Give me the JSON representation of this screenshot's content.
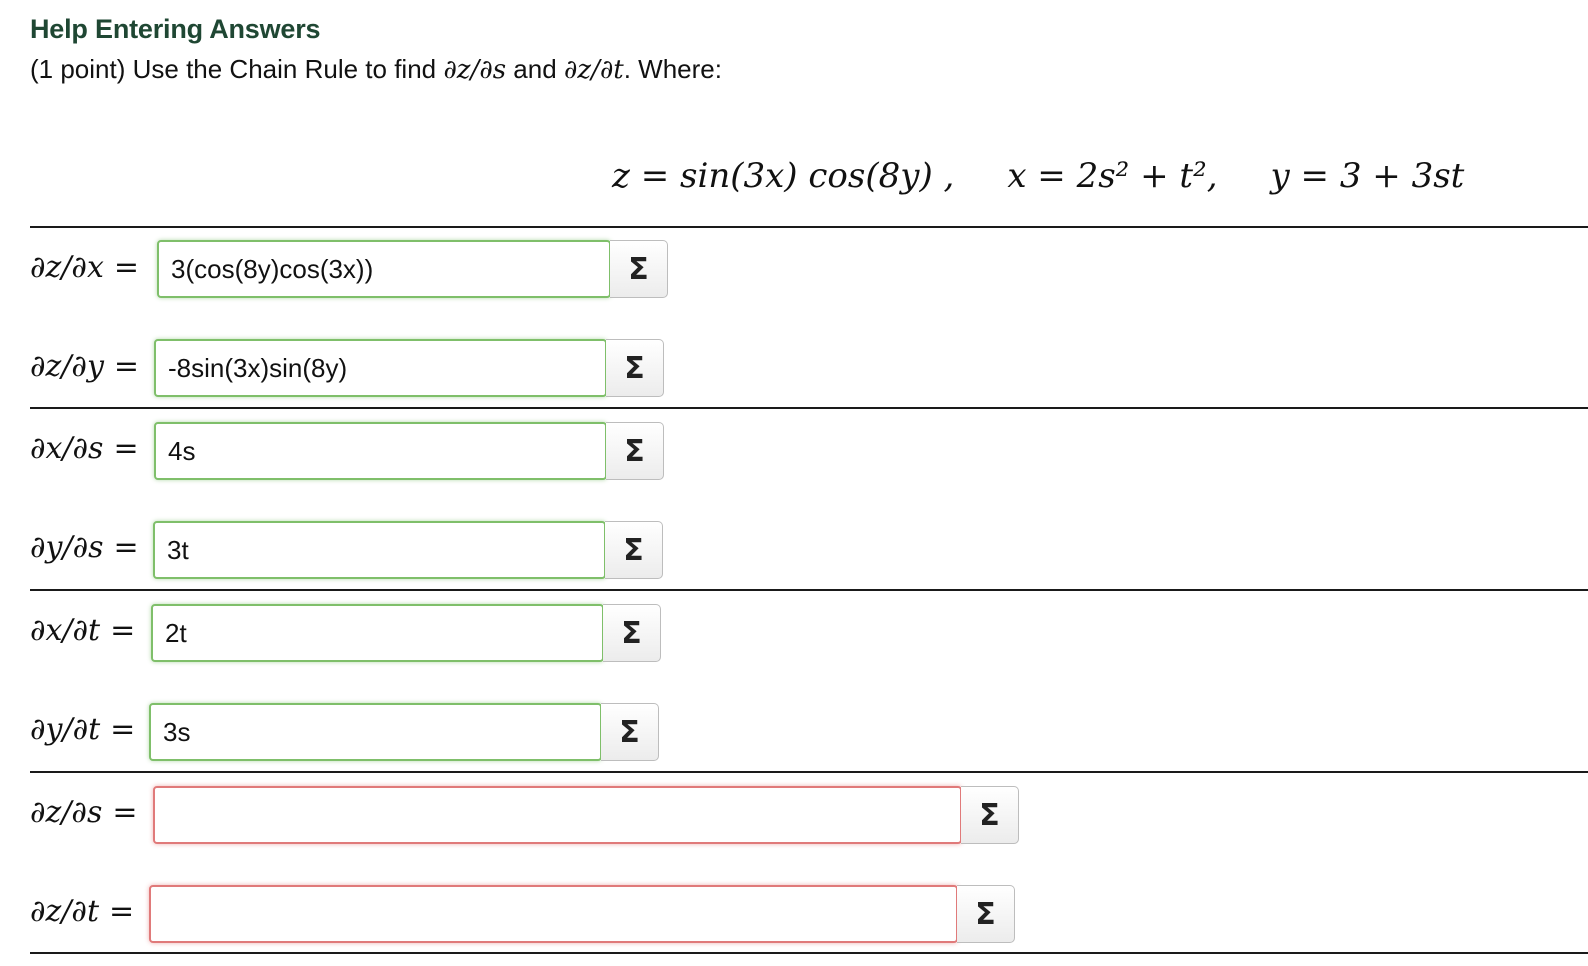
{
  "header": {
    "help_link": "Help Entering Answers"
  },
  "problem": {
    "prefix": "(1 point) Use the Chain Rule to find",
    "target1": "∂z/∂s",
    "connector": "and",
    "target2": "∂z/∂t",
    "suffix": ". Where:"
  },
  "equation": {
    "z": "z = sin(3x) cos(8y) ,",
    "x": "x = 2s² + t²,",
    "y": "y = 3 + 3st"
  },
  "rows": [
    {
      "label": "∂z/∂x",
      "equals": "=",
      "value": "3(cos(8y)cos(3x))",
      "status": "correct",
      "sigma": "Σ"
    },
    {
      "label": "∂z/∂y",
      "equals": "=",
      "value": "-8sin(3x)sin(8y)",
      "status": "correct",
      "sigma": "Σ"
    },
    {
      "label": "∂x/∂s",
      "equals": "=",
      "value": "4s",
      "status": "correct",
      "sigma": "Σ"
    },
    {
      "label": "∂y/∂s",
      "equals": "=",
      "value": "3t",
      "status": "correct",
      "sigma": "Σ"
    },
    {
      "label": "∂x/∂t",
      "equals": "=",
      "value": "2t",
      "status": "correct",
      "sigma": "Σ"
    },
    {
      "label": "∂y/∂t",
      "equals": "=",
      "value": "3s",
      "status": "correct",
      "sigma": "Σ"
    },
    {
      "label": "∂z/∂s",
      "equals": "=",
      "value": "",
      "status": "incorrect",
      "sigma": "Σ"
    },
    {
      "label": "∂z/∂t",
      "equals": "=",
      "value": "",
      "status": "incorrect",
      "sigma": "Σ"
    }
  ],
  "colors": {
    "help_link": "#1f4733",
    "correct_border": "#7fbf6a",
    "incorrect_border": "#e07a7a"
  }
}
